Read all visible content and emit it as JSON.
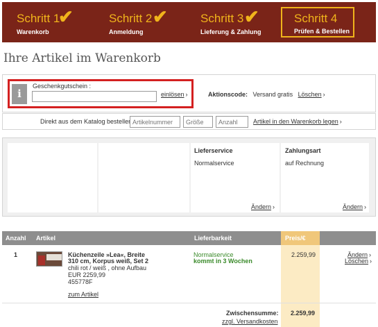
{
  "steps": [
    {
      "label": "Schritt 1",
      "sub": "Warenkorb",
      "done": true
    },
    {
      "label": "Schritt 2",
      "sub": "Anmeldung",
      "done": true
    },
    {
      "label": "Schritt 3",
      "sub": "Lieferung & Zahlung",
      "done": true
    },
    {
      "label": "Schritt 4",
      "sub": "Prüfen & Bestellen",
      "done": false
    }
  ],
  "check_glyph": "✔",
  "page_title": "Ihre Artikel im Warenkorb",
  "voucher": {
    "info_glyph": "i",
    "label": "Geschenkgutschein :",
    "value": "",
    "redeem": "einlösen"
  },
  "promo": {
    "label": "Aktionscode:",
    "value": "Versand gratis",
    "delete": "Löschen"
  },
  "catalog": {
    "label": "Direkt aus dem Katalog bestellen:",
    "item_placeholder": "Artikelnummer",
    "size_placeholder": "Größe",
    "qty_placeholder": "Anzahl",
    "add_link": "Artikel in den Warenkorb legen"
  },
  "delivery": {
    "title": "Lieferservice",
    "value": "Normalservice",
    "change": "Ändern"
  },
  "payment": {
    "title": "Zahlungsart",
    "value": "auf Rechnung",
    "change": "Ändern"
  },
  "chevron": "›",
  "cart": {
    "headers": {
      "qty": "Anzahl",
      "item": "Artikel",
      "availability": "Lieferbarkeit",
      "price": "Preis/€"
    },
    "rows": [
      {
        "qty": "1",
        "name_line1": "Küchenzeile »Lea«, Breite",
        "name_line2": "310 cm, Korpus weiß, Set 2",
        "variant": "chili rot / weiß , ohne Aufbau",
        "unit_price": "EUR 2259,99",
        "article_no": "455778F",
        "item_link": "zum Artikel",
        "service": "Normalservice",
        "delivery_time": "kommt in 3 Wochen",
        "price": "2.259,99",
        "change": "Ändern",
        "delete": "Löschen"
      }
    ],
    "subtotal_label": "Zwischensumme:",
    "subtotal_value": "2.259,99",
    "shipping_link": "zzgl. Versandkosten"
  }
}
